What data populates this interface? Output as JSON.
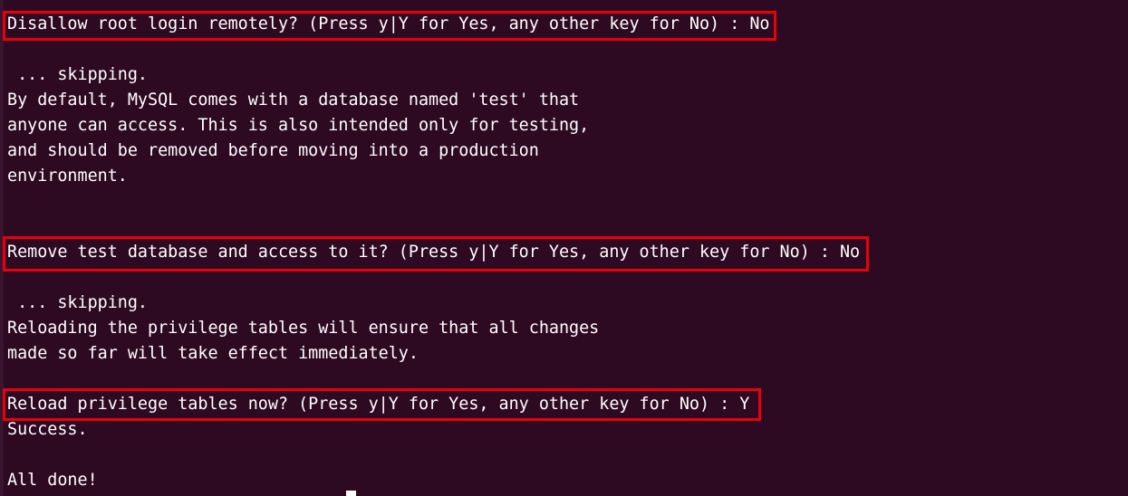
{
  "terminal": {
    "prompt_disallow_root": "Disallow root login remotely? (Press y|Y for Yes, any other key for No) : No",
    "skip_1": " ... skipping.",
    "test_db_info": [
      "By default, MySQL comes with a database named 'test' that",
      "anyone can access. This is also intended only for testing,",
      "and should be removed before moving into a production",
      "environment."
    ],
    "prompt_remove_test_db": "Remove test database and access to it? (Press y|Y for Yes, any other key for No) : No",
    "skip_2": " ... skipping.",
    "reload_info": [
      "Reloading the privilege tables will ensure that all changes",
      "made so far will take effect immediately."
    ],
    "prompt_reload_privileges": "Reload privilege tables now? (Press y|Y for Yes, any other key for No) : Y",
    "success": "Success.",
    "all_done": "All done!"
  },
  "colors": {
    "background": "#2d0922",
    "text": "#ffffff",
    "highlight_border": "#e8000b"
  }
}
